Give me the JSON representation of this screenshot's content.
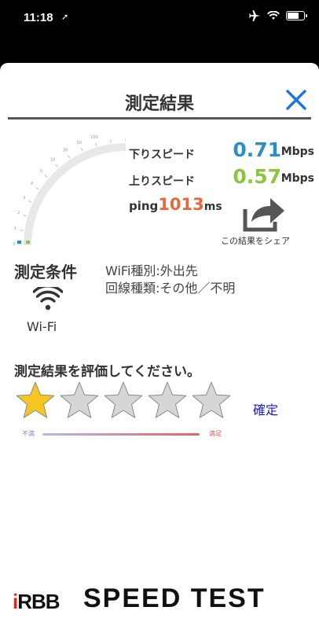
{
  "status_bar": {
    "time": "11:18",
    "location_arrow": "location-arrow-icon",
    "battery_level": 0.75
  },
  "modal": {
    "title": "測定結果",
    "close_icon": "close-x-icon"
  },
  "gauge": {
    "ticks": [
      "10",
      "30",
      "50",
      "100",
      "300",
      "1G"
    ],
    "tick_marks": [
      "0",
      "1",
      "2",
      "3",
      "4",
      "5",
      "10",
      "30",
      "50",
      "100",
      "300",
      "1G"
    ],
    "level_download": 0.02,
    "level_upload": 0.02
  },
  "result": {
    "download_label": "下りスピード",
    "download_value": "0.71",
    "download_unit": "Mbps",
    "upload_label": "上りスピード",
    "upload_value": "0.57",
    "upload_unit": "Mbps",
    "ping_label": "ping",
    "ping_value": "1013",
    "ping_unit": "ms"
  },
  "share": {
    "label": "この結果をシェア",
    "icon": "share-arrow-icon"
  },
  "conditions": {
    "title": "測定条件",
    "network_icon": "wifi-icon",
    "network_label": "Wi-Fi",
    "wifi_type": "WiFi種別:外出先",
    "line_type": "回線種類:その他／不明"
  },
  "evaluation": {
    "title": "測定結果を評価してください。",
    "rating": 1,
    "max": 5,
    "confirm_label": "確定",
    "low_label": "不満",
    "high_label": "満足"
  },
  "brand": {
    "logo": "RBB",
    "logo_i": "i",
    "name": "SPEED TEST"
  },
  "colors": {
    "download": "#2c8ec6",
    "upload": "#8cc63f",
    "ping": "#e8683c",
    "star_active": "#f5c522",
    "star_inactive": "#d6d6d6",
    "accent": "#1a73e8"
  }
}
